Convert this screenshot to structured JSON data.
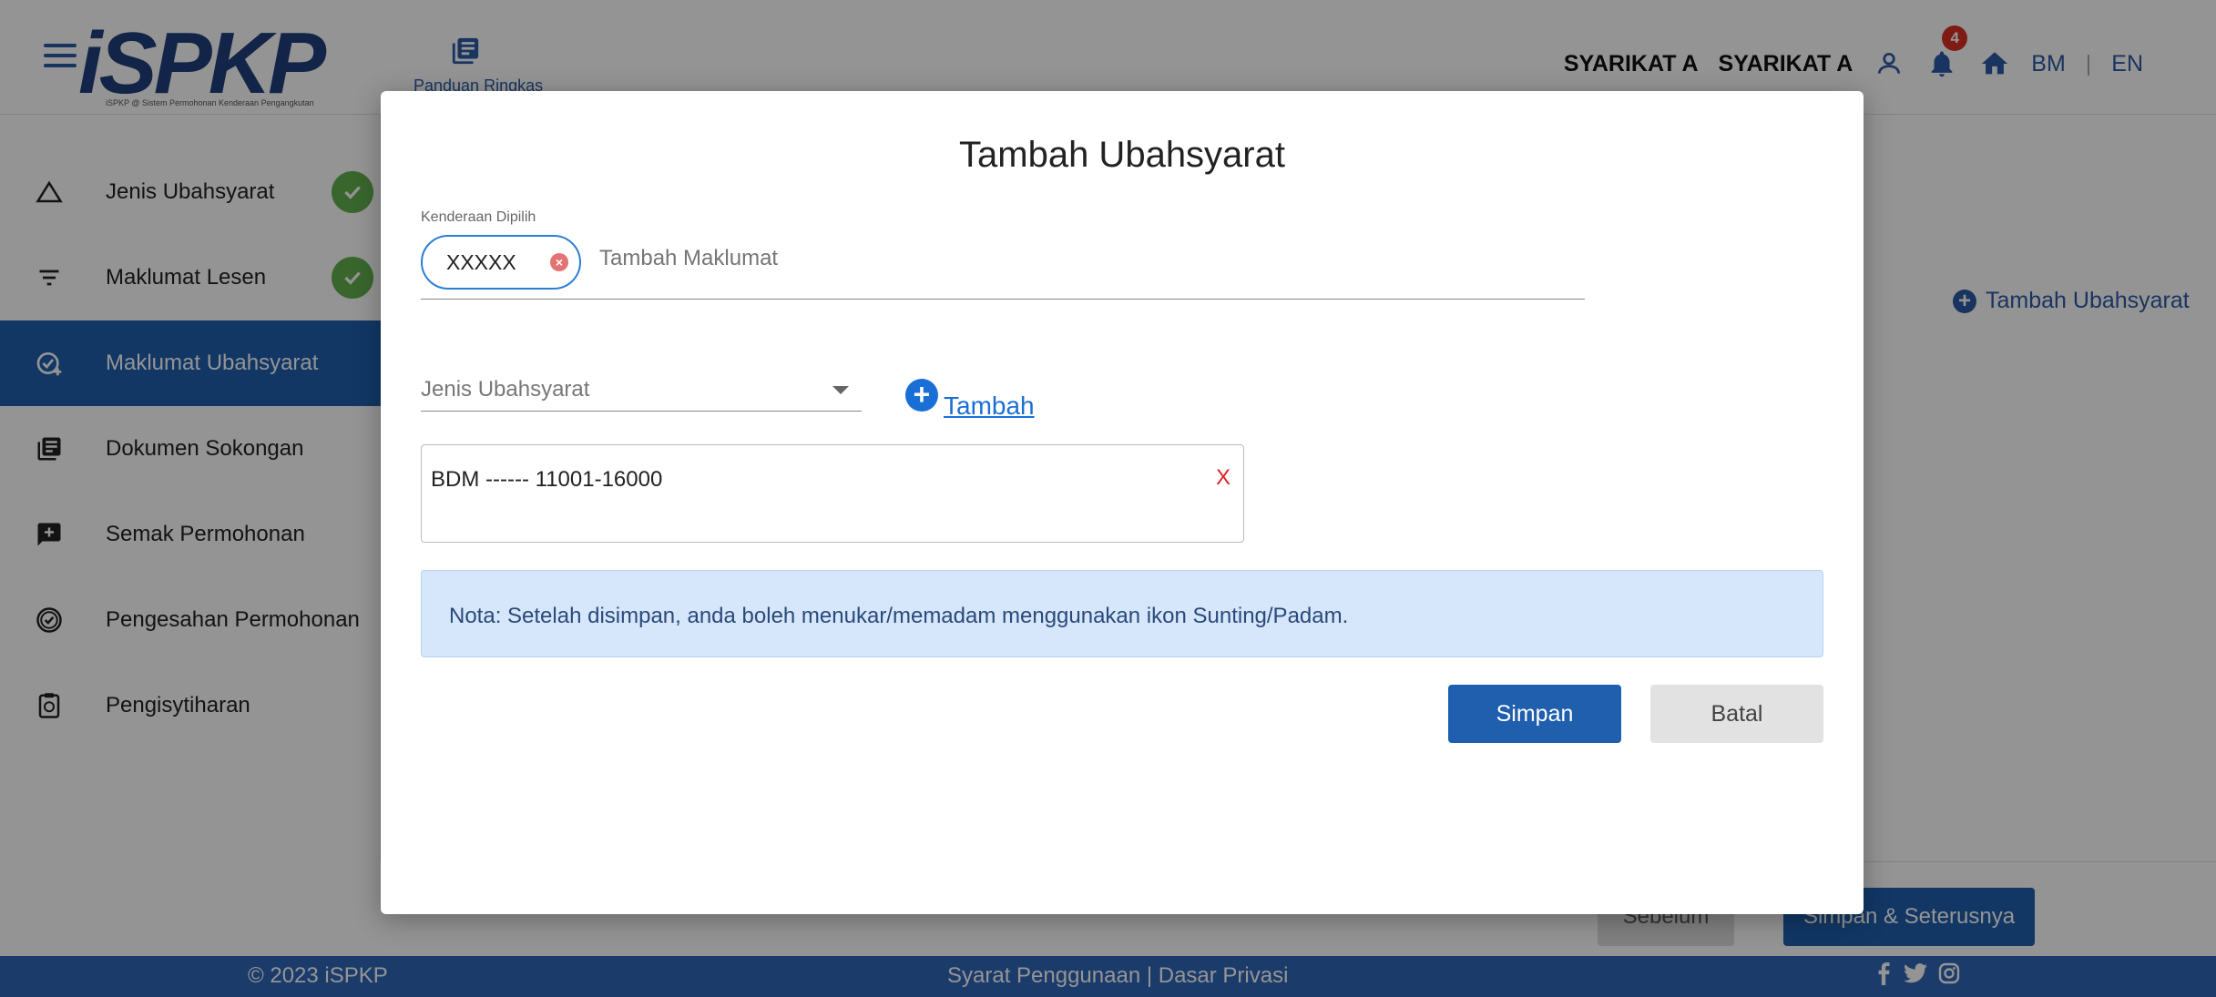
{
  "header": {
    "logo_text": "iSPKP",
    "logo_subtitle": "iSPKP @ Sistem Permohonan Kenderaan Pengangkutan",
    "guide_label": "Panduan Ringkas",
    "company_1": "SYARIKAT A",
    "company_2": "SYARIKAT A",
    "notification_count": "4",
    "lang_bm": "BM",
    "lang_sep": "|",
    "lang_en": "EN"
  },
  "sidebar": {
    "items": [
      {
        "label": "Jenis Ubahsyarat",
        "icon": "triangle-icon",
        "done": true
      },
      {
        "label": "Maklumat Lesen",
        "icon": "filter-lines-icon",
        "done": true
      },
      {
        "label": "Maklumat Ubahsyarat",
        "icon": "check-add-icon",
        "done": false
      },
      {
        "label": "Dokumen Sokongan",
        "icon": "document-stack-icon",
        "done": false
      },
      {
        "label": "Semak Permohonan",
        "icon": "review-add-icon",
        "done": false
      },
      {
        "label": "Pengesahan Permohonan",
        "icon": "verified-badge-icon",
        "done": false
      },
      {
        "label": "Pengisytiharan",
        "icon": "clipboard-icon",
        "done": false
      }
    ]
  },
  "content": {
    "add_label": "Tambah Ubahsyarat",
    "prev_label": "Sebelum",
    "next_label": "Simpan & Seterusnya"
  },
  "modal": {
    "title": "Tambah Ubahsyarat",
    "vehicle_caption": "Kenderaan Dipilih",
    "vehicle_chip": "XXXXX",
    "vehicle_placeholder": "Tambah Maklumat",
    "type_placeholder": "Jenis Ubahsyarat",
    "add_label": "Tambah",
    "list_item": "BDM ------ 11001-16000",
    "remove_label": "X",
    "note": "Nota: Setelah disimpan, anda boleh menukar/memadam menggunakan ikon Sunting/Padam.",
    "save_label": "Simpan",
    "cancel_label": "Batal"
  },
  "footer": {
    "copyright": "© 2023 iSPKP",
    "links": "Syarat Penggunaan | Dasar Privasi"
  },
  "colors": {
    "primary": "#1f5fae",
    "footer": "#2f67b8",
    "success": "#62b04e",
    "danger": "#e02020",
    "note_bg": "#d6e6fb"
  }
}
